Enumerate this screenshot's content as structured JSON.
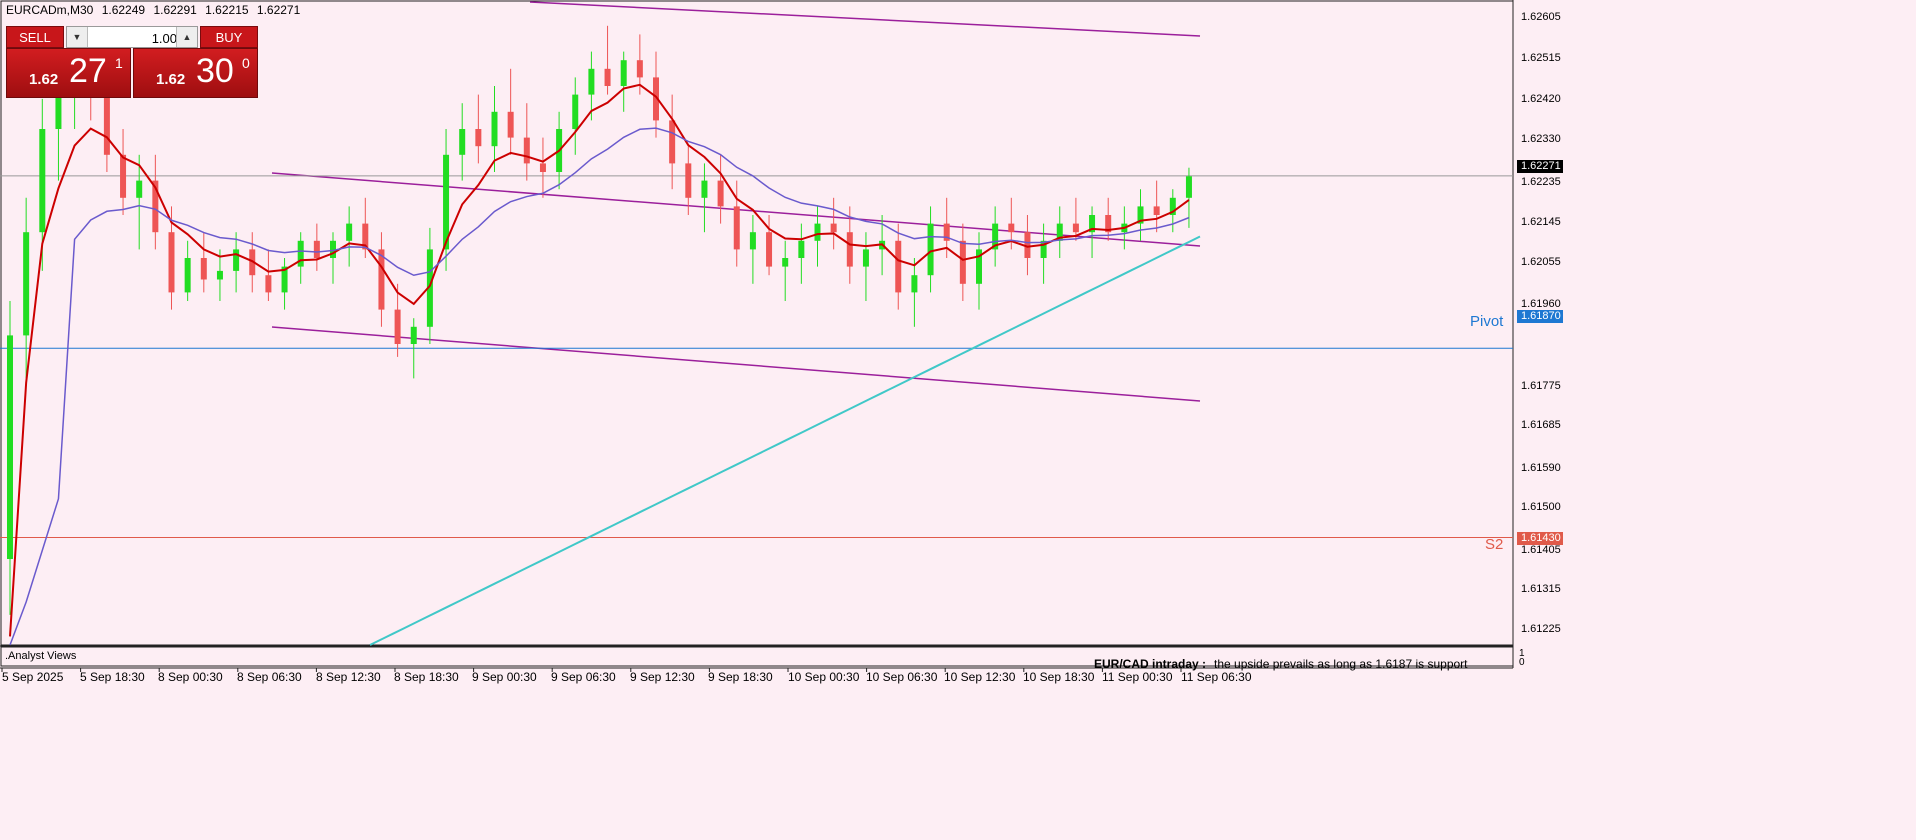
{
  "header": {
    "symbol": "EURCADm,M30",
    "open": "1.62249",
    "high": "1.62291",
    "low": "1.62215",
    "close": "1.62271"
  },
  "trade_panel": {
    "sell_label": "SELL",
    "buy_label": "BUY",
    "lot_value": "1.00",
    "bid": {
      "small": "1.62",
      "big": "27",
      "sup": "1"
    },
    "ask": {
      "small": "1.62",
      "big": "30",
      "sup": "0"
    }
  },
  "colors": {
    "background": "#fdeef4",
    "bull": "#22dd22",
    "bear": "#ee5555",
    "ma_fast": "#cc0000",
    "ma_mid": "#6a5acd",
    "ma_slow": "#40c8c8",
    "channel": "#9b1f9b",
    "pivot": "#1e78d2",
    "s2": "#e05a4a"
  },
  "price_axis": {
    "ticks": [
      "1.62605",
      "1.62515",
      "1.62420",
      "1.62330",
      "1.62235",
      "1.62145",
      "1.62055",
      "1.61960",
      "1.61775",
      "1.61685",
      "1.61590",
      "1.61500",
      "1.61405",
      "1.61315",
      "1.61225"
    ],
    "current_price": "1.62271",
    "pivot_price": "1.61870",
    "s2_price": "1.61430"
  },
  "levels": {
    "pivot_label": "Pivot",
    "s2_label": "S2"
  },
  "time_axis": [
    "5 Sep 2025",
    "5 Sep 18:30",
    "8 Sep 00:30",
    "8 Sep 06:30",
    "8 Sep 12:30",
    "8 Sep 18:30",
    "9 Sep 00:30",
    "9 Sep 06:30",
    "9 Sep 12:30",
    "9 Sep 18:30",
    "10 Sep 00:30",
    "10 Sep 06:30",
    "10 Sep 12:30",
    "10 Sep 18:30",
    "11 Sep 00:30",
    "11 Sep 06:30"
  ],
  "subwindow": {
    "title": ".Analyst Views",
    "headline": "EUR/CAD intraday :",
    "comment": "the upside prevails as long as 1.6187 is support",
    "scale_top": "1",
    "scale_bottom": "0"
  },
  "chart_data": {
    "type": "candlestick",
    "symbol": "EURCADm",
    "timeframe": "M30",
    "ylim": [
      1.6118,
      1.6268
    ],
    "candles": [
      [
        1.6138,
        1.6198,
        1.6125,
        1.619
      ],
      [
        1.619,
        1.6222,
        1.618,
        1.6214
      ],
      [
        1.6214,
        1.6245,
        1.6205,
        1.6238
      ],
      [
        1.6238,
        1.6256,
        1.6226,
        1.625
      ],
      [
        1.625,
        1.626,
        1.6238,
        1.6254
      ],
      [
        1.6254,
        1.626,
        1.624,
        1.6246
      ],
      [
        1.6246,
        1.6252,
        1.6228,
        1.6232
      ],
      [
        1.6232,
        1.6238,
        1.6218,
        1.6222
      ],
      [
        1.6222,
        1.6232,
        1.621,
        1.6226
      ],
      [
        1.6226,
        1.6232,
        1.621,
        1.6214
      ],
      [
        1.6214,
        1.622,
        1.6196,
        1.62
      ],
      [
        1.62,
        1.6212,
        1.6198,
        1.6208
      ],
      [
        1.6208,
        1.6214,
        1.62,
        1.6203
      ],
      [
        1.6203,
        1.621,
        1.6198,
        1.6205
      ],
      [
        1.6205,
        1.6214,
        1.62,
        1.621
      ],
      [
        1.621,
        1.6214,
        1.62,
        1.6204
      ],
      [
        1.6204,
        1.621,
        1.6198,
        1.62
      ],
      [
        1.62,
        1.6208,
        1.6196,
        1.6206
      ],
      [
        1.6206,
        1.6214,
        1.6202,
        1.6212
      ],
      [
        1.6212,
        1.6216,
        1.6205,
        1.6208
      ],
      [
        1.6208,
        1.6214,
        1.6202,
        1.6212
      ],
      [
        1.6212,
        1.622,
        1.6206,
        1.6216
      ],
      [
        1.6216,
        1.6222,
        1.6208,
        1.621
      ],
      [
        1.621,
        1.6214,
        1.6192,
        1.6196
      ],
      [
        1.6196,
        1.6202,
        1.6185,
        1.6188
      ],
      [
        1.6188,
        1.6194,
        1.618,
        1.6192
      ],
      [
        1.6192,
        1.6215,
        1.6188,
        1.621
      ],
      [
        1.621,
        1.6238,
        1.6205,
        1.6232
      ],
      [
        1.6232,
        1.6244,
        1.6226,
        1.6238
      ],
      [
        1.6238,
        1.6246,
        1.623,
        1.6234
      ],
      [
        1.6234,
        1.6248,
        1.6228,
        1.6242
      ],
      [
        1.6242,
        1.6252,
        1.6232,
        1.6236
      ],
      [
        1.6236,
        1.6244,
        1.6226,
        1.623
      ],
      [
        1.623,
        1.6236,
        1.6222,
        1.6228
      ],
      [
        1.6228,
        1.6242,
        1.6224,
        1.6238
      ],
      [
        1.6238,
        1.625,
        1.6232,
        1.6246
      ],
      [
        1.6246,
        1.6256,
        1.624,
        1.6252
      ],
      [
        1.6252,
        1.6262,
        1.6246,
        1.6248
      ],
      [
        1.6248,
        1.6256,
        1.6242,
        1.6254
      ],
      [
        1.6254,
        1.626,
        1.6246,
        1.625
      ],
      [
        1.625,
        1.6256,
        1.6236,
        1.624
      ],
      [
        1.624,
        1.6246,
        1.6224,
        1.623
      ],
      [
        1.623,
        1.6234,
        1.6218,
        1.6222
      ],
      [
        1.6222,
        1.623,
        1.6214,
        1.6226
      ],
      [
        1.6226,
        1.6232,
        1.6216,
        1.622
      ],
      [
        1.622,
        1.6226,
        1.6206,
        1.621
      ],
      [
        1.621,
        1.6218,
        1.6202,
        1.6214
      ],
      [
        1.6214,
        1.6218,
        1.6204,
        1.6206
      ],
      [
        1.6206,
        1.6212,
        1.6198,
        1.6208
      ],
      [
        1.6208,
        1.6216,
        1.6202,
        1.6212
      ],
      [
        1.6212,
        1.622,
        1.6206,
        1.6216
      ],
      [
        1.6216,
        1.6222,
        1.621,
        1.6214
      ],
      [
        1.6214,
        1.622,
        1.6202,
        1.6206
      ],
      [
        1.6206,
        1.6214,
        1.6198,
        1.621
      ],
      [
        1.621,
        1.6218,
        1.6204,
        1.6212
      ],
      [
        1.6212,
        1.6216,
        1.6196,
        1.62
      ],
      [
        1.62,
        1.6208,
        1.6192,
        1.6204
      ],
      [
        1.6204,
        1.622,
        1.62,
        1.6216
      ],
      [
        1.6216,
        1.6222,
        1.6208,
        1.6212
      ],
      [
        1.6212,
        1.6216,
        1.6198,
        1.6202
      ],
      [
        1.6202,
        1.6214,
        1.6196,
        1.621
      ],
      [
        1.621,
        1.622,
        1.6206,
        1.6216
      ],
      [
        1.6216,
        1.6222,
        1.621,
        1.6214
      ],
      [
        1.6214,
        1.6218,
        1.6204,
        1.6208
      ],
      [
        1.6208,
        1.6216,
        1.6202,
        1.6212
      ],
      [
        1.6212,
        1.622,
        1.6208,
        1.6216
      ],
      [
        1.6216,
        1.6222,
        1.6212,
        1.6214
      ],
      [
        1.6214,
        1.622,
        1.6208,
        1.6218
      ],
      [
        1.6218,
        1.6222,
        1.6212,
        1.6214
      ],
      [
        1.6214,
        1.622,
        1.621,
        1.6216
      ],
      [
        1.6216,
        1.6224,
        1.6212,
        1.622
      ],
      [
        1.622,
        1.6226,
        1.6214,
        1.6218
      ],
      [
        1.6218,
        1.6224,
        1.6214,
        1.6222
      ],
      [
        1.6222,
        1.6229,
        1.6215,
        1.6227
      ]
    ],
    "moving_averages": [
      {
        "type": "fast MA",
        "color": "#cc0000"
      },
      {
        "type": "mid MA",
        "color": "#6a5acd"
      },
      {
        "type": "slow MA",
        "color": "#40c8c8"
      }
    ],
    "horizontal_levels": [
      {
        "label": "Pivot",
        "value": 1.6187,
        "color": "#1e78d2"
      },
      {
        "label": "S2",
        "value": 1.6143,
        "color": "#e05a4a"
      }
    ]
  }
}
